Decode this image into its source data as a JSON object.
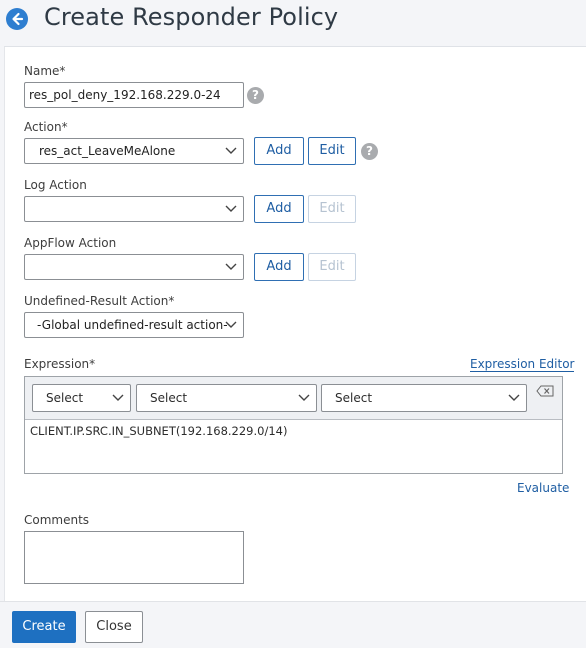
{
  "page": {
    "title": "Create Responder Policy"
  },
  "name": {
    "label": "Name*",
    "value": "res_pol_deny_192.168.229.0-24",
    "help": "?"
  },
  "action": {
    "label": "Action*",
    "value": "res_act_LeaveMeAlone",
    "add": "Add",
    "edit": "Edit",
    "help": "?"
  },
  "log_action": {
    "label": "Log Action",
    "value": "",
    "add": "Add",
    "edit": "Edit"
  },
  "appflow_action": {
    "label": "AppFlow Action",
    "value": "",
    "add": "Add",
    "edit": "Edit"
  },
  "undef_action": {
    "label": "Undefined-Result Action*",
    "value": "-Global undefined-result action-"
  },
  "expression": {
    "label": "Expression*",
    "editor_link": "Expression Editor",
    "selects": [
      "Select",
      "Select",
      "Select"
    ],
    "value": "CLIENT.IP.SRC.IN_SUBNET(192.168.229.0/14)",
    "evaluate_link": "Evaluate"
  },
  "comments": {
    "label": "Comments",
    "value": ""
  },
  "footer": {
    "create": "Create",
    "close": "Close"
  },
  "colors": {
    "primary": "#1e70c1",
    "link": "#1f5ea3",
    "back_icon": "#2e7ed0"
  },
  "icons": {
    "back": "arrow-left-circle-icon",
    "dropdown": "chevron-down-icon",
    "clear": "backspace-clear-icon",
    "help": "question-circle-icon"
  }
}
